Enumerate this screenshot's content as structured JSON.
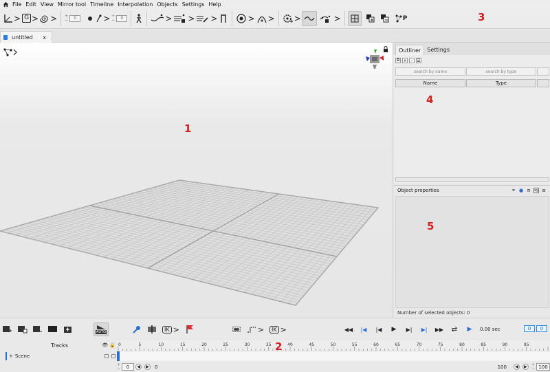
{
  "menu": [
    "File",
    "Edit",
    "View",
    "Mirror tool",
    "Timeline",
    "Interpolation",
    "Objects",
    "Settings",
    "Help"
  ],
  "toolbar": {
    "g_label": "G",
    "stepper1_value": "0",
    "stepper2_value": "0",
    "ik_label": "IK",
    "p_label": "P"
  },
  "markers": {
    "m1": "1",
    "m2": "2",
    "m3": "3",
    "m4": "4",
    "m5": "5"
  },
  "doc_tab": {
    "title": "untitled",
    "close": "x"
  },
  "right_panel": {
    "tabs": [
      "Outliner",
      "Settings"
    ],
    "search_name_placeholder": "search by name",
    "search_type_placeholder": "search by type",
    "col_name": "Name",
    "col_type": "Type",
    "props_title": "Object properties",
    "pi_label": "π",
    "selected_label": "Number of selected objects: 0"
  },
  "bottom": {
    "auto_label": "AUTO",
    "ik_label": "IK",
    "ik2_label": "IK",
    "time_label": "0.00 sec",
    "time_box1": "0",
    "time_box2": "0"
  },
  "timeline": {
    "tracks_label": "Tracks",
    "scene_label": "Scene",
    "ticks": [
      "0",
      "5",
      "10",
      "15",
      "20",
      "25",
      "30",
      "35",
      "40",
      "45",
      "50",
      "55",
      "60",
      "65",
      "70",
      "75",
      "80",
      "85",
      "90",
      "95"
    ],
    "start_value": "0",
    "pos_value": "0",
    "end_value": "100",
    "end_box": "100"
  },
  "colors": {
    "accent": "#2c8ae0",
    "marker": "#d32020",
    "flag": "#d83030"
  }
}
